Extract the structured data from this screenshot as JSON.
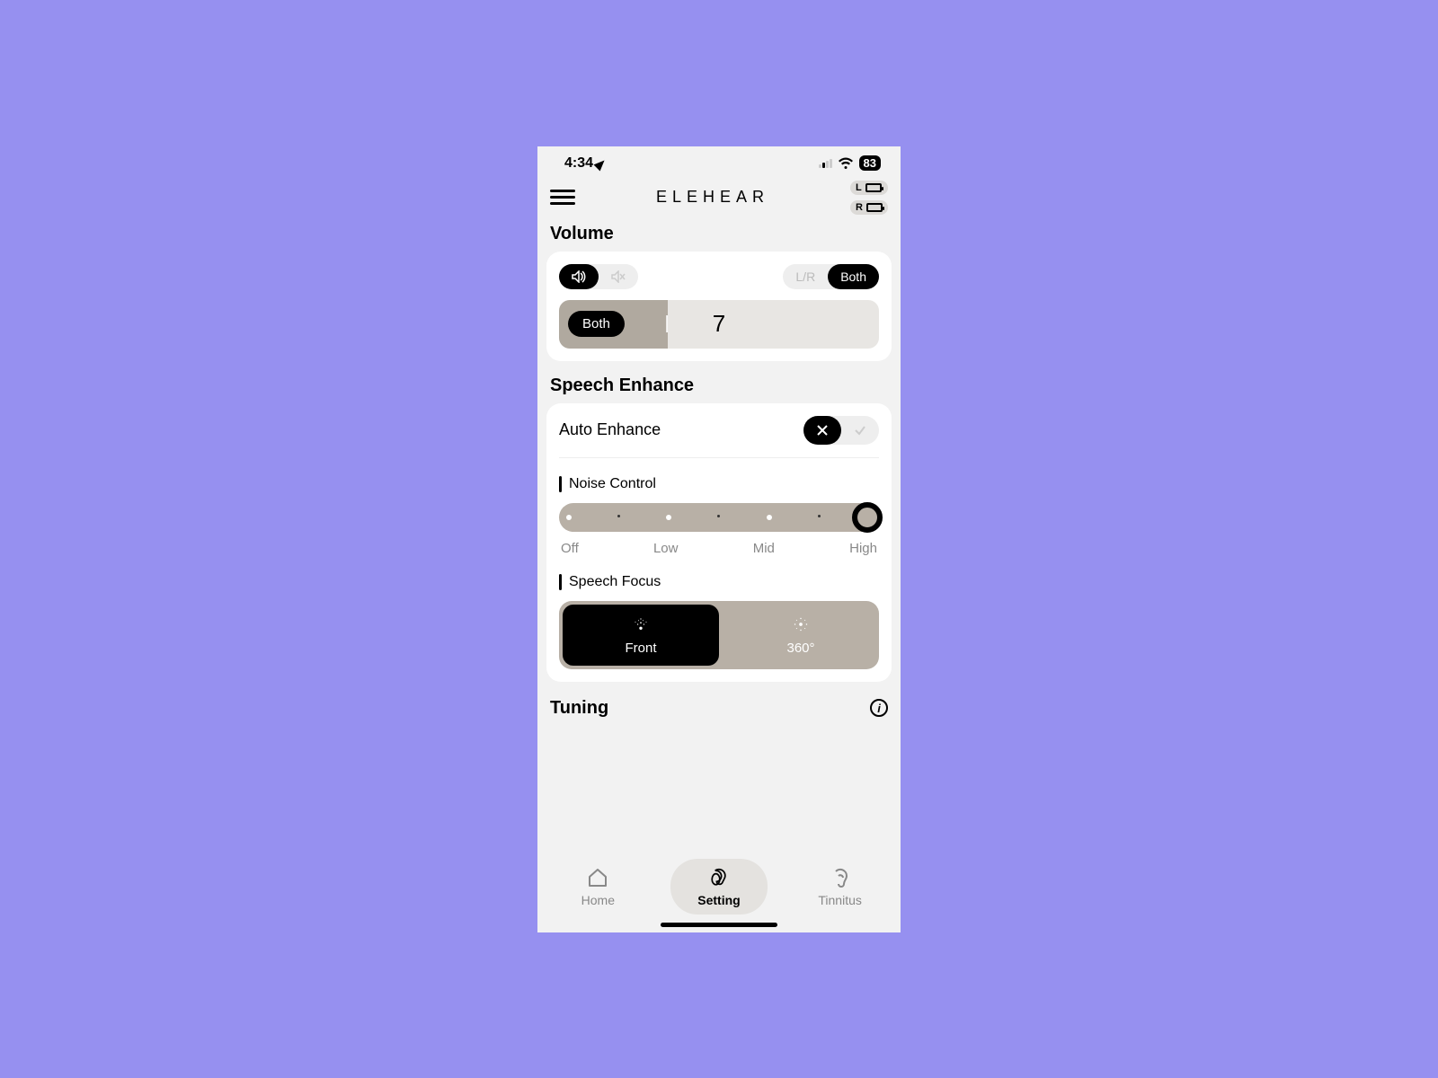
{
  "status": {
    "time": "4:34",
    "battery_pct": "83"
  },
  "header": {
    "brand": "ELEHEAR",
    "batt_L": "L",
    "batt_R": "R"
  },
  "volume": {
    "title": "Volume",
    "lr_label": "L/R",
    "both_label": "Both",
    "badge": "Both",
    "value": "7"
  },
  "speech": {
    "title": "Speech Enhance",
    "auto_label": "Auto Enhance",
    "noise_label": "Noise Control",
    "scale": {
      "off": "Off",
      "low": "Low",
      "mid": "Mid",
      "high": "High"
    },
    "focus_label": "Speech Focus",
    "front": "Front",
    "around": "360°"
  },
  "tuning": {
    "title": "Tuning"
  },
  "nav": {
    "home": "Home",
    "setting": "Setting",
    "tinnitus": "Tinnitus"
  }
}
